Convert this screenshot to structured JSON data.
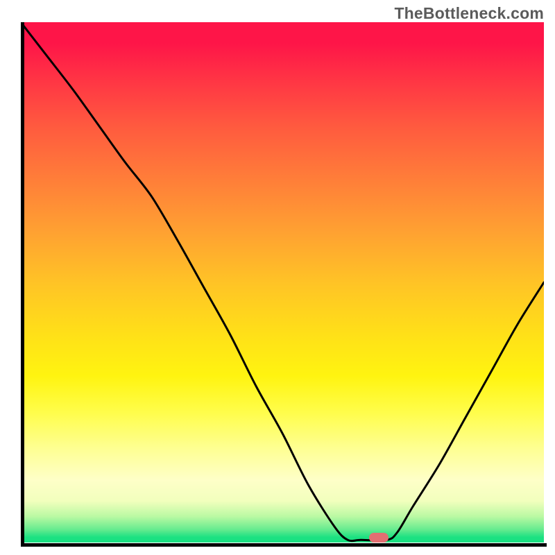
{
  "watermark": "TheBottleneck.com",
  "colors": {
    "gradient_top": "#fe1548",
    "gradient_mid": "#ffe018",
    "gradient_bottom": "#1be182",
    "curve": "#000000",
    "axes": "#000000",
    "marker": "#e36f72"
  },
  "chart_data": {
    "type": "line",
    "title": "",
    "xlabel": "",
    "ylabel": "",
    "xlim": [
      0,
      1
    ],
    "ylim": [
      0,
      100
    ],
    "note": "x is normalized horizontal position (0=left edge of plot, 1=right); y is bottleneck percentage (0=bottom/green, 100=top/red). Curve estimated from plot.",
    "series": [
      {
        "name": "bottleneck-curve",
        "x": [
          0.0,
          0.05,
          0.1,
          0.15,
          0.2,
          0.25,
          0.3,
          0.35,
          0.4,
          0.45,
          0.5,
          0.55,
          0.6,
          0.625,
          0.65,
          0.7,
          0.72,
          0.75,
          0.8,
          0.85,
          0.9,
          0.95,
          1.0
        ],
        "y": [
          100,
          93.5,
          87,
          80,
          73,
          66.5,
          58,
          49,
          40,
          30,
          21,
          11,
          3,
          0.5,
          0.5,
          0.5,
          2,
          7,
          15,
          24,
          33,
          42,
          50
        ]
      }
    ],
    "marker": {
      "x_frac": 0.684,
      "y_value": 1.0,
      "label": ""
    }
  }
}
